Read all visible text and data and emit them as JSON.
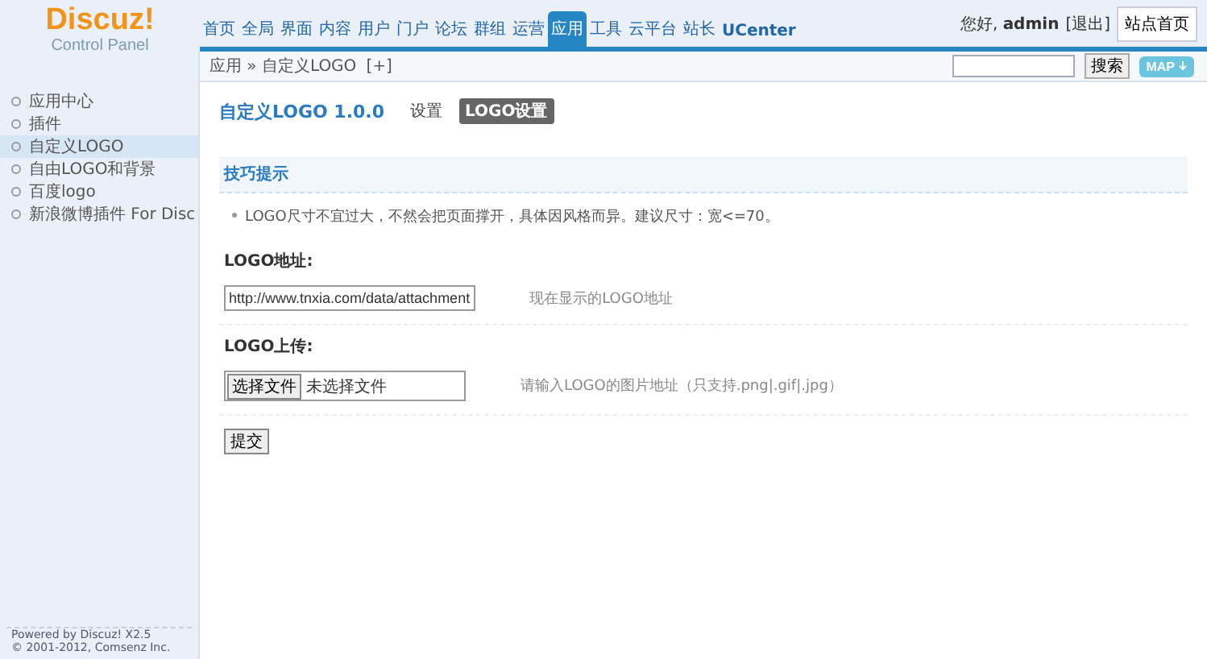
{
  "logo": {
    "title": "Discuz!",
    "subtitle": "Control Panel"
  },
  "nav": [
    {
      "label": "首页",
      "selected": false
    },
    {
      "label": "全局",
      "selected": false
    },
    {
      "label": "界面",
      "selected": false
    },
    {
      "label": "内容",
      "selected": false
    },
    {
      "label": "用户",
      "selected": false
    },
    {
      "label": "门户",
      "selected": false
    },
    {
      "label": "论坛",
      "selected": false
    },
    {
      "label": "群组",
      "selected": false
    },
    {
      "label": "运营",
      "selected": false
    },
    {
      "label": "应用",
      "selected": true
    },
    {
      "label": "工具",
      "selected": false
    },
    {
      "label": "云平台",
      "selected": false
    },
    {
      "label": "站长",
      "selected": false
    },
    {
      "label": "UCenter",
      "selected": false
    }
  ],
  "user": {
    "greeting": "您好,",
    "username": "admin",
    "logout": "[退出]",
    "home_button": "站点首页"
  },
  "breadcrumb": {
    "path": "应用 » 自定义LOGO",
    "add": "[+]"
  },
  "search": {
    "button": "搜索"
  },
  "map_button": "MAP",
  "sidebar": {
    "items": [
      {
        "label": "应用中心",
        "selected": false
      },
      {
        "label": "插件",
        "selected": false
      },
      {
        "label": "自定义LOGO",
        "selected": true
      },
      {
        "label": "自由LOGO和背景",
        "selected": false
      },
      {
        "label": "百度logo",
        "selected": false
      },
      {
        "label": "新浪微博插件 For Disc",
        "selected": false
      }
    ],
    "footer": [
      "Powered by Discuz! X2.5",
      "© 2001-2012, Comsenz Inc."
    ]
  },
  "content": {
    "title": "自定义LOGO 1.0.0",
    "subtabs": [
      {
        "label": "设置",
        "selected": false
      },
      {
        "label": "LOGO设置",
        "selected": true
      }
    ],
    "tips": {
      "title": "技巧提示",
      "items": [
        "LOGO尺寸不宜过大，不然会把页面撑开，具体因风格而异。建议尺寸：宽<=70。"
      ]
    },
    "fields": [
      {
        "kind": "text",
        "label": "LOGO地址:",
        "value": "http://www.tnxia.com/data/attachment",
        "hint": "现在显示的LOGO地址"
      },
      {
        "kind": "file",
        "label": "LOGO上传:",
        "button": "选择文件",
        "value": "未选择文件",
        "hint": "请输入LOGO的图片地址（只支持.png|.gif|.jpg）"
      }
    ],
    "submit": "提交"
  }
}
